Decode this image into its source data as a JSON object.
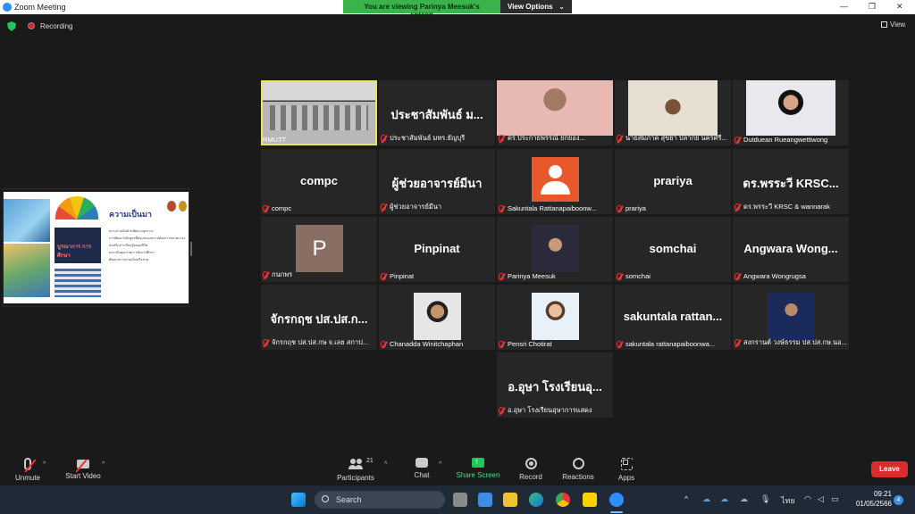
{
  "window": {
    "title": "Zoom Meeting",
    "minimize": "—",
    "restore": "❐",
    "close": "✕"
  },
  "banner": {
    "viewing_text": "You are viewing Parinya Meesuk's screen",
    "view_options": "View Options",
    "view_options_caret": "⌄"
  },
  "topbar": {
    "recording_label": "Recording",
    "view_label": "View"
  },
  "slide": {
    "title": "ความเป็นมา",
    "book_text": "บูรณาการ การศึกษา",
    "bullets": [
      "ความร่วมมือด้านพัฒนาบุคลากร",
      "การพัฒนาหลักสูตรที่ตอบสนองความต้องการตลาดแรงงาน",
      "ส่งเสริมการเรียนรู้ตลอดชีวิต",
      "ยกระดับคุณภาพการจัดการศึกษา",
      "พัฒนาความร่วมมือเครือข่าย"
    ]
  },
  "participants": [
    {
      "display": "",
      "nameplate": "RMUTT",
      "muted": false,
      "video": "vid-room",
      "active": true
    },
    {
      "display": "ประชาสัมพันธ์ ม...",
      "nameplate": "ประชาสัมพันธ์ มทร.ธัญบุรี",
      "muted": true
    },
    {
      "display": "",
      "nameplate": "ดร.ประกายพรรณ์ ยกย่อง...",
      "muted": true,
      "video": "vid-pink"
    },
    {
      "display": "",
      "nameplate": "นายสมภาค สุขยา ปลากย นครศรี...",
      "muted": true,
      "video": "vid-man"
    },
    {
      "display": "",
      "nameplate": "Dutduean Rueangwettiwong",
      "muted": true,
      "video": "vid-woman-red"
    },
    {
      "display": "compc",
      "nameplate": "compc",
      "muted": true
    },
    {
      "display": "ผู้ช่วยอาจารย์มีนา",
      "nameplate": "ผู้ช่วยอาจารย์มีนา",
      "muted": true
    },
    {
      "display": "",
      "nameplate": "Sakuntala Rattanapaiboonw...",
      "muted": true,
      "avatar": "orange"
    },
    {
      "display": "prariya",
      "nameplate": "prariya",
      "muted": true
    },
    {
      "display": "ดร.พรระวี KRSC...",
      "nameplate": "ดร.พรระวี KRSC & wannarak",
      "muted": true
    },
    {
      "display": "",
      "nameplate": "กนกพร",
      "muted": true,
      "avatar": "P"
    },
    {
      "display": "Pinpinat",
      "nameplate": "Pinpinat",
      "muted": true
    },
    {
      "display": "",
      "nameplate": "Parinya Meesuk",
      "muted": true,
      "video": "vid-man2"
    },
    {
      "display": "somchai",
      "nameplate": "somchai",
      "muted": true
    },
    {
      "display": "Angwara Wong...",
      "nameplate": "Angwara Wongrugsa",
      "muted": true
    },
    {
      "display": "จักรกฤช ปส.ปส.ก...",
      "nameplate": "จักรกฤช ปส.ปส.กษ จ.เลย สกาป...",
      "muted": true
    },
    {
      "display": "",
      "nameplate": "Chanadda Winitchaphan",
      "muted": true,
      "video": "vid-woman2"
    },
    {
      "display": "",
      "nameplate": "Pensri Chotirat",
      "muted": true,
      "video": "vid-woman3"
    },
    {
      "display": "sakuntala rattan...",
      "nameplate": "sakuntala rattanapaiboonwa...",
      "muted": true
    },
    {
      "display": "",
      "nameplate": "สงกรานต์ วงษ์ธรรม ปส.ปส.กษ.นอ...",
      "muted": true,
      "video": "vid-man3"
    },
    {
      "display": "อ.อุษา โรงเรียนอุ...",
      "nameplate": "อ.อุษา โรงเรียนอุษาการแสดง",
      "muted": true
    }
  ],
  "toolbar": {
    "unmute": "Unmute",
    "start_video": "Start Video",
    "participants": "Participants",
    "participants_count": "21",
    "chat": "Chat",
    "share_screen": "Share Screen",
    "record": "Record",
    "reactions": "Reactions",
    "apps": "Apps",
    "leave": "Leave",
    "caret": "^"
  },
  "taskbar": {
    "search": "Search",
    "lang": "ไทย",
    "time": "09:21",
    "date": "01/05/2566",
    "notifications": "4",
    "tray_up": "^"
  },
  "colors": {
    "share_green": "#22c55e",
    "leave_red": "#d92d2d",
    "active_border": "#e5e560",
    "zoom_blue": "#2d8cff"
  }
}
